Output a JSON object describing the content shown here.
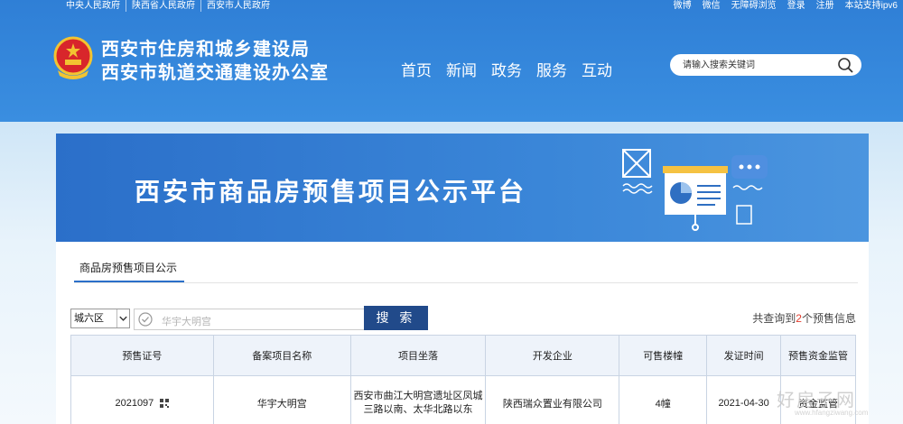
{
  "topbar": {
    "left_links": [
      "中央人民政府",
      "陕西省人民政府",
      "西安市人民政府"
    ],
    "right_links": [
      "微博",
      "微信",
      "无障碍浏览",
      "登录",
      "注册",
      "本站支持ipv6"
    ]
  },
  "site": {
    "title_line1": "西安市住房和城乡建设局",
    "title_line2": "西安市轨道交通建设办公室"
  },
  "nav": [
    "首页",
    "新闻",
    "政务",
    "服务",
    "互动"
  ],
  "header_search": {
    "placeholder": "请输入搜索关键词",
    "icon": "search-icon"
  },
  "banner": {
    "title": "西安市商品房预售项目公示平台"
  },
  "tabs": {
    "active": "商品房预售项目公示"
  },
  "filter": {
    "district": "城六区",
    "query_value": "华宇大明宫",
    "search_button": "搜 索",
    "result_prefix": "共查询到",
    "result_count": "2",
    "result_suffix": "个预售信息"
  },
  "table": {
    "headers": [
      "预售证号",
      "备案项目名称",
      "项目坐落",
      "开发企业",
      "可售楼幢",
      "发证时间",
      "预售资金监管"
    ],
    "rows": [
      {
        "cert_no": "2021097",
        "project": "华宇大明宫",
        "location": "西安市曲江大明宫遗址区凤城三路以南、太华北路以东",
        "developer": "陕西瑞众置业有限公司",
        "buildings": "4幢",
        "issue_date": "2021-04-30",
        "fund": "资金监管"
      }
    ]
  },
  "watermark": {
    "text": "好房子网",
    "url": "www.hfangziwang.com"
  },
  "colors": {
    "header_blue": "#2f7fd6",
    "button_navy": "#214a8a",
    "count_red": "#e23c2c"
  }
}
